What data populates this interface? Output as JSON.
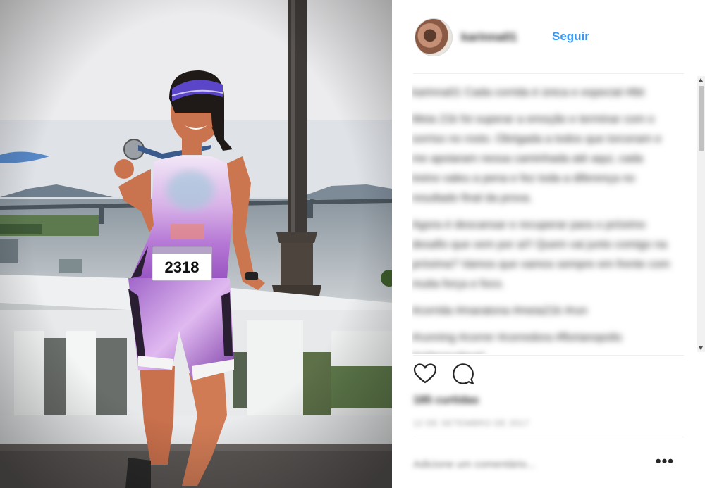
{
  "post": {
    "bib_number": "2318"
  },
  "header": {
    "username": "karinna01",
    "follow_label": "Seguir"
  },
  "caption": {
    "paragraphs": [
      "karinna01 Cada corrida é única e especial #tbt",
      "Meia 21k foi superar a emoção e terminar com o sorriso no rosto. Obrigada a todos que torceram e me apoiaram nessa caminhada até aqui, cada treino valeu a pena e fez toda a diferença no resultado final da prova.",
      "Agora é descansar e recuperar para o próximo desafio que vem por aí!! Quem vai junto comigo na próxima? Vamos que vamos sempre em frente com muita força e foco.",
      "#corrida #maratona #meia21k #run",
      "#running #correr #corredora #florianopolis #vidasaudavel"
    ]
  },
  "actions": {
    "like_icon": "heart-icon",
    "comment_icon": "comment-icon"
  },
  "likes_label": "185 curtidas",
  "timestamp": "12 DE SETEMBRO DE 2017",
  "comment": {
    "placeholder": "Adicione um comentário...",
    "more_label": "•••"
  }
}
